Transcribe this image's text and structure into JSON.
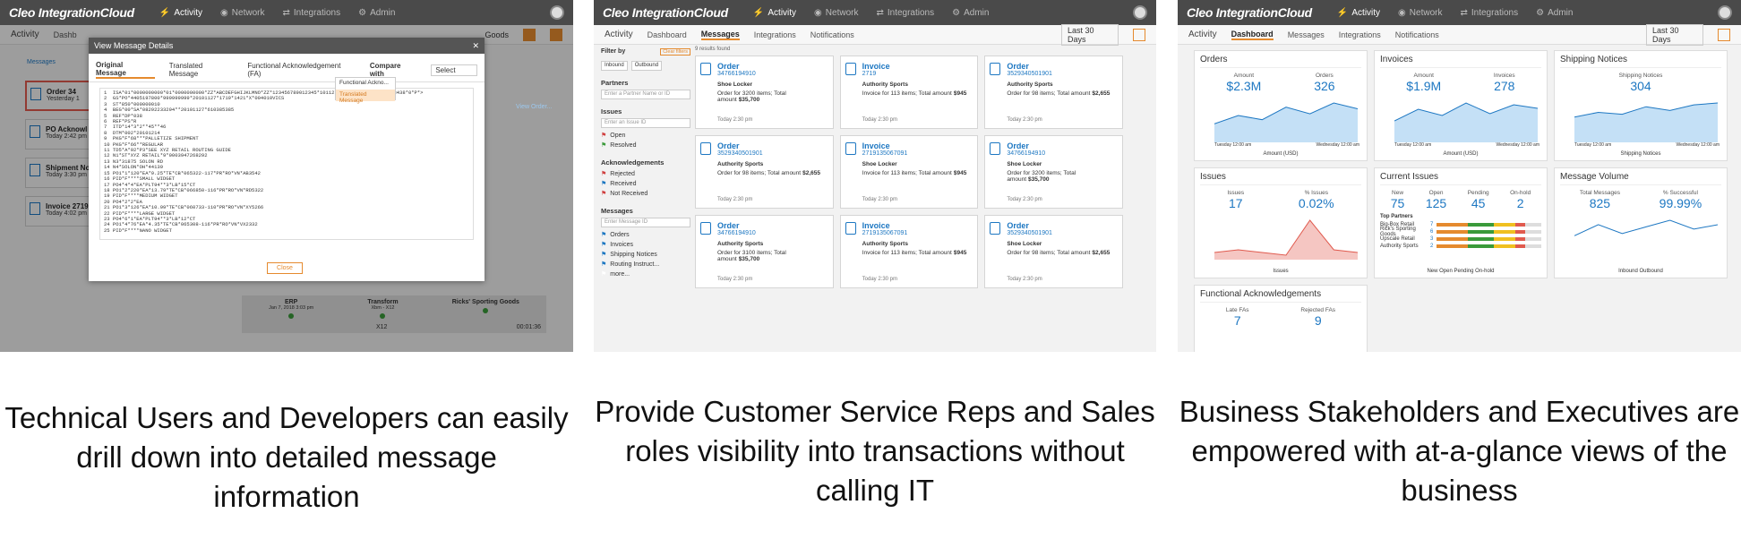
{
  "brand": "Cleo IntegrationCloud",
  "nav": [
    "Activity",
    "Network",
    "Integrations",
    "Admin"
  ],
  "s1": {
    "subtitle": "Activity",
    "tabs": [
      "Dashb"
    ],
    "goods": "Goods",
    "crumb": "Messages",
    "list": [
      {
        "t": "Order 34",
        "d": "Yesterday 1"
      },
      {
        "t": "PO Acknowl",
        "d": "Today 2:42 pm"
      },
      {
        "t": "Shipment No",
        "d": "Today 3:30 pm"
      },
      {
        "t": "Invoice 2719",
        "d": "Today 4:02 pm"
      }
    ],
    "modal_title": "View Message Details",
    "modal_tabs": [
      "Original Message",
      "Translated Message",
      "Functional Acknowledgement (FA)"
    ],
    "compare": "Compare with",
    "select": "Select",
    "dd": [
      "Functional Ackno...",
      "Translated Message"
    ],
    "view": "View Order...",
    "close": "Close",
    "code": "1  ISA*01*0000000000*01*0000000000*ZZ*ABCDEFGHIJKLMNO*ZZ*123456789012345*101127*1719*U*00400*000003438*0*P*>\n2  GS*PO*4405197800*999999999*20101127*1719*1421*X*004010VICS\n3  ST*850*000000010\n4  BEG*00*SA*08292233294**20101127*610385385\n5  REF*DP*038\n6  REF*PS*R\n7  ITD*14*3*2**45**46\n8  DTM*002*20101214\n9  PKG*F*68***PALLETIZE SHIPMENT\n10 PKG*F*66**REGULAR\n11 TD5*A*92*P3*SEE XYZ RETAIL ROUTING GUIDE\n12 N1*ST*XYZ RETAIL*9*0003947268292\n13 N3*31875 SOLON RD\n14 N4*SOLON*OH*44139\n15 PO1*1*120*EA*9.25*TE*CB*065322-117*PR*RO*VN*AB3542\n16 PID*F****SMALL WIDGET\n17 PO4*4*4*EA*PLT94**3*LB*15*CT\n18 PO1*2*220*EA*13.79*TE*CB*066850-116*PR*RO*VN*RD5322\n19 PID*F****MEDIUM WIDGET\n20 PO4*2*2*EA\n21 PO1*3*126*EA*10.99*TE*CB*060733-110*PR*RO*VN*XY5266\n22 PID*F****LARGE WIDGET\n23 PO4*6*1*EA*PLT94**3*LB*12*CT\n24 PO1*4*76*EA*4.35*TE*CB*065308-116*PR*RO*VN*VX2332\n25 PID*F****NANO WIDGET",
    "flow": [
      {
        "t": "ERP",
        "d": "Jan 7, 2018 3:03 pm"
      },
      {
        "t": "Transform",
        "d": "Xbm - X12"
      },
      {
        "t": "Ricks' Sporting Goods",
        "d": ""
      }
    ],
    "flow_code": "X12",
    "timer": "00:01:36"
  },
  "s2": {
    "subtitle": "Activity",
    "tabs": [
      "Dashboard",
      "Messages",
      "Integrations",
      "Notifications"
    ],
    "range": "Last 30 Days",
    "results": "9 results found",
    "filter": "Filter by",
    "clear": "Clear filters",
    "dir": [
      "Inbound",
      "Outbound"
    ],
    "partners": "Partners",
    "partner_ph": "Enter a Partner Name or ID",
    "issues": "Issues",
    "issue_ph": "Enter an Issue ID",
    "issue_opts": [
      "Open",
      "Resolved"
    ],
    "acks": "Acknowledgements",
    "ack_opts": [
      "Rejected",
      "Received",
      "Not Received"
    ],
    "messages": "Messages",
    "msg_ph": "Enter Message ID",
    "msg_types": [
      "Orders",
      "Invoices",
      "Shipping Notices",
      "Routing Instruct...",
      "more..."
    ],
    "cards": [
      {
        "t": "Order",
        "id": "34766194910",
        "c": "Shoe Locker",
        "l": "Order for 3200 items; Total amount",
        "a": "$35,700",
        "d": "Today 2:30 pm"
      },
      {
        "t": "Invoice",
        "id": "2719",
        "c": "Authority Sports",
        "l": "Invoice for 113 items; Total amount",
        "a": "$945",
        "d": "Today 2:30 pm"
      },
      {
        "t": "Order",
        "id": "3529340501901",
        "c": "Authority Sports",
        "l": "Order for 98 items; Total amount",
        "a": "$2,655",
        "d": "Today 2:30 pm"
      },
      {
        "t": "Order",
        "id": "3529340501901",
        "c": "Authority Sports",
        "l": "Order for 98 items; Total amount",
        "a": "$2,655",
        "d": "Today 2:30 pm"
      },
      {
        "t": "Invoice",
        "id": "2719135067091",
        "c": "Shoe Locker",
        "l": "Invoice for 113 items; Total amount",
        "a": "$945",
        "d": "Today 2:30 pm"
      },
      {
        "t": "Order",
        "id": "34766194910",
        "c": "Shoe Locker",
        "l": "Order for 3200 items; Total amount",
        "a": "$35,700",
        "d": "Today 2:30 pm"
      },
      {
        "t": "Order",
        "id": "34766194910",
        "c": "Authority Sports",
        "l": "Order for 3100 items; Total amount",
        "a": "$35,700",
        "d": "Today 2:30 pm"
      },
      {
        "t": "Invoice",
        "id": "2719135067091",
        "c": "Authority Sports",
        "l": "Invoice for 113 items; Total amount",
        "a": "$945",
        "d": "Today 2:30 pm"
      },
      {
        "t": "Order",
        "id": "3529340501901",
        "c": "Shoe Locker",
        "l": "Order for 98 items; Total amount",
        "a": "$2,655",
        "d": "Today 2:30 pm"
      }
    ]
  },
  "s3": {
    "subtitle": "Activity",
    "tabs": [
      "Dashboard",
      "Messages",
      "Integrations",
      "Notifications"
    ],
    "range": "Last 30 Days",
    "p": [
      {
        "h": "Orders",
        "k": [
          {
            "l": "Amount",
            "v": "$2.3M"
          },
          {
            "l": "Orders",
            "v": "326"
          }
        ],
        "leg": "Amount (USD)"
      },
      {
        "h": "Invoices",
        "k": [
          {
            "l": "Amount",
            "v": "$1.9M"
          },
          {
            "l": "Invoices",
            "v": "278"
          }
        ],
        "leg": "Amount (USD)"
      },
      {
        "h": "Shipping Notices",
        "k": [
          {
            "l": "Shipping Notices",
            "v": "304"
          }
        ],
        "leg": "Shipping Notices"
      },
      {
        "h": "Issues",
        "k": [
          {
            "l": "Issues",
            "v": "17"
          },
          {
            "l": "% Issues",
            "v": "0.02%"
          }
        ],
        "leg": "Issues"
      },
      {
        "h": "Current Issues",
        "k": [
          {
            "l": "New",
            "v": "75"
          },
          {
            "l": "Open",
            "v": "125"
          },
          {
            "l": "Pending",
            "v": "45"
          },
          {
            "l": "On-hold",
            "v": "2"
          }
        ],
        "leg": "New  Open  Pending  On-hold"
      },
      {
        "h": "Message Volume",
        "k": [
          {
            "l": "Total Messages",
            "v": "825"
          },
          {
            "l": "% Successful",
            "v": "99.99%"
          }
        ],
        "leg": "Inbound  Outbound"
      },
      {
        "h": "Functional Acknowledgements",
        "k": [
          {
            "l": "Late FAs",
            "v": "7"
          },
          {
            "l": "Rejected FAs",
            "v": "9"
          }
        ],
        "leg": ""
      }
    ],
    "top": "Top Partners",
    "partners": [
      {
        "n": "Big-Box Retail",
        "v": "7"
      },
      {
        "n": "Rick's Sporting Goods",
        "v": "6"
      },
      {
        "n": "Upscale Retail",
        "v": "3"
      },
      {
        "n": "Authority Sports",
        "v": "2"
      }
    ],
    "xl": [
      "Tuesday 12:00 am",
      "Wednesday 12:00 am"
    ]
  },
  "captions": [
    "Technical Users and Developers can easily drill down into detailed message information",
    "Provide Customer Service Reps and Sales roles visibility into transactions without calling IT",
    "Business Stakeholders and Executives are empowered with at-a-glance views of the business"
  ],
  "colors": {
    "accent": "#e58a2e",
    "blue": "#1d77c2",
    "topbar": "#4a4a4a"
  }
}
